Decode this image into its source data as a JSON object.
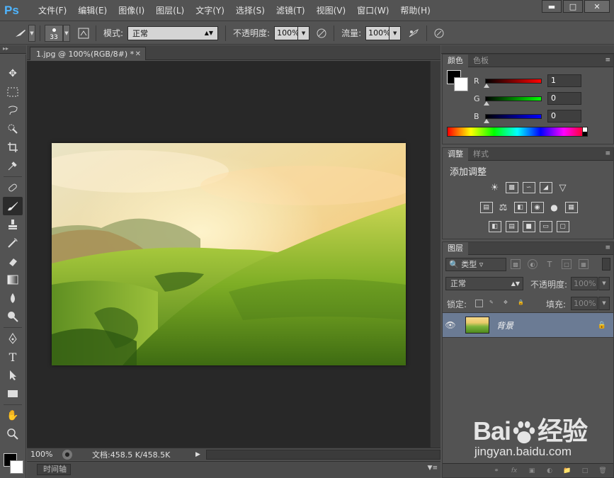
{
  "app": {
    "logo": "Ps"
  },
  "menu": [
    "文件(F)",
    "编辑(E)",
    "图像(I)",
    "图层(L)",
    "文字(Y)",
    "选择(S)",
    "滤镜(T)",
    "视图(V)",
    "窗口(W)",
    "帮助(H)"
  ],
  "options": {
    "brush_size": "33",
    "mode_label": "模式:",
    "mode_value": "正常",
    "opacity_label": "不透明度:",
    "opacity_value": "100%",
    "flow_label": "流量:",
    "flow_value": "100%"
  },
  "document": {
    "tab_title": "1.jpg @ 100%(RGB/8#) *",
    "zoom": "100%",
    "doc_info": "文档:458.5 K/458.5K",
    "timeline_tab": "时间轴"
  },
  "color_panel": {
    "tabs": [
      "颜色",
      "色板"
    ],
    "r_label": "R",
    "r_value": "1",
    "g_label": "G",
    "g_value": "0",
    "b_label": "B",
    "b_value": "0"
  },
  "adjust_panel": {
    "tabs": [
      "调整",
      "样式"
    ],
    "title": "添加调整"
  },
  "layers_panel": {
    "tab": "图层",
    "filter_kind": "类型",
    "blend_mode": "正常",
    "opacity_label": "不透明度:",
    "opacity_value": "100%",
    "lock_label": "锁定:",
    "fill_label": "填充:",
    "fill_value": "100%",
    "layer_name": "背景"
  },
  "watermark": {
    "brand_left": "Bai",
    "brand_right": "经验",
    "url": "jingyan.baidu.com"
  },
  "colors": {
    "ui_bg": "#535353",
    "canvas_bg": "#282828",
    "selected_layer": "#6b7b94"
  }
}
